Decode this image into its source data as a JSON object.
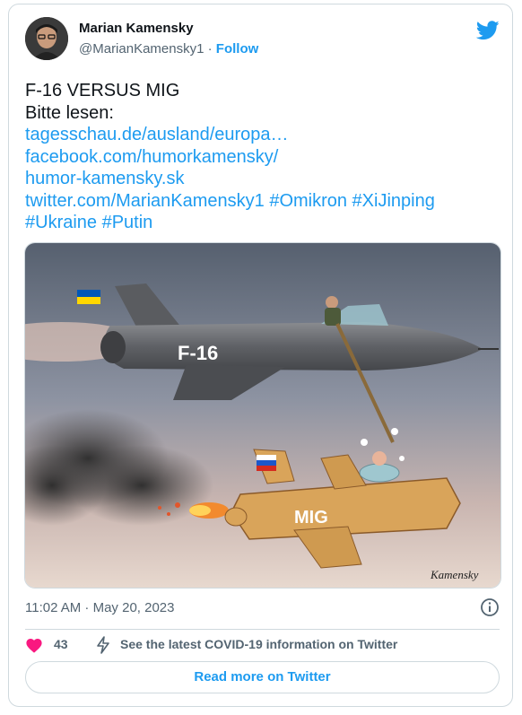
{
  "author": {
    "name": "Marian Kamensky",
    "handle": "@MarianKamensky1",
    "separator": "·",
    "follow_label": "Follow"
  },
  "tweet": {
    "lines": [
      {
        "text": "F-16 VERSUS MIG",
        "link": false
      },
      {
        "text": "Bitte lesen:",
        "link": false
      },
      {
        "text": "tagesschau.de/ausland/europa…",
        "link": true
      },
      {
        "text": "facebook.com/humorkamensky/",
        "link": true
      },
      {
        "text": "humor-kamensky.sk",
        "link": true
      },
      {
        "text": "twitter.com/MarianKamensky1 #Omikron #XiJinping",
        "link": true
      },
      {
        "text": "#Ukraine #Putin",
        "link": true
      }
    ]
  },
  "media": {
    "jet_label": "F-16",
    "coffin_label": "MIG",
    "signature": "Kamensky"
  },
  "timestamp": "11:02 AM · May 20, 2023",
  "likes": "43",
  "covid_notice": "See the latest COVID-19 information on Twitter",
  "read_more_label": "Read more on Twitter",
  "colors": {
    "accent": "#1d9bf0",
    "like": "#f91880",
    "text_secondary": "#536471"
  },
  "icons": [
    "twitter-bird-icon",
    "info-icon",
    "heart-icon",
    "lightning-icon"
  ]
}
